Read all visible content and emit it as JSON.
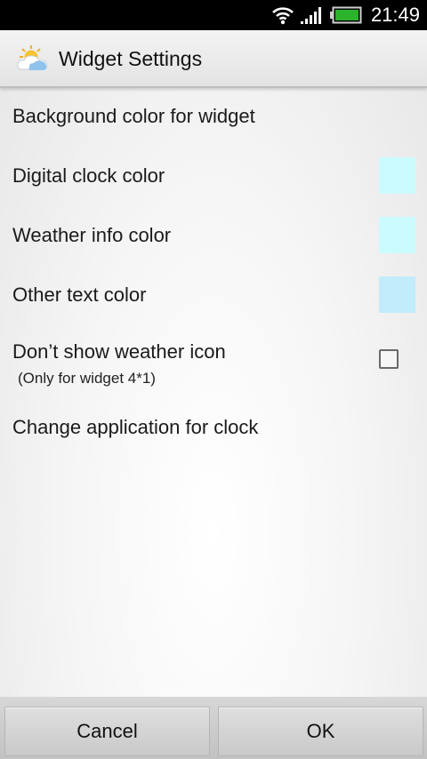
{
  "status_bar": {
    "time": "21:49",
    "icons": [
      "wifi-icon",
      "signal-icon",
      "battery-icon"
    ],
    "battery_color": "#2bb32b"
  },
  "title_bar": {
    "icon": "weather-cloud-sun-icon",
    "title": "Widget Settings"
  },
  "preferences": [
    {
      "label": "Background color for widget"
    },
    {
      "label": "Digital clock color",
      "swatch_color": "#ccfbff"
    },
    {
      "label": "Weather info color",
      "swatch_color": "#ccfbff"
    },
    {
      "label": "Other text color",
      "swatch_color": "#c2ecfb"
    },
    {
      "label": "Don’t show weather icon",
      "summary": "(Only for widget 4*1)",
      "checked": false
    },
    {
      "label": "Change application for clock"
    }
  ],
  "buttons": {
    "cancel": "Cancel",
    "ok": "OK"
  }
}
